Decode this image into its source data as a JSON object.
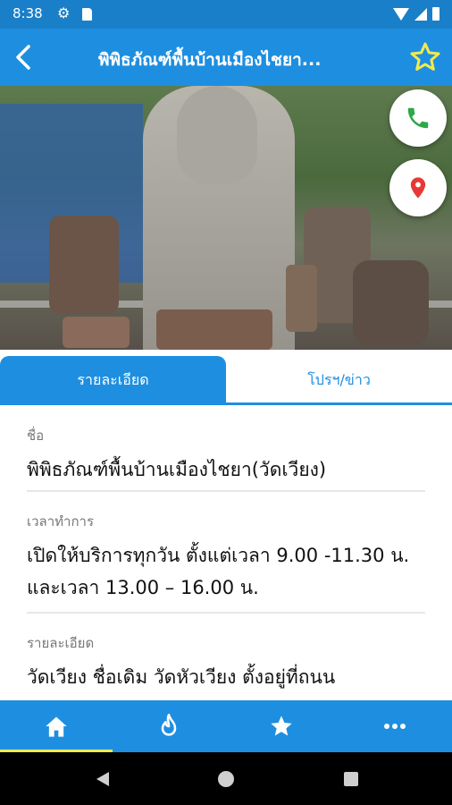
{
  "status_bar": {
    "time": "8:38",
    "icons": [
      "gear-icon",
      "sd-card-icon",
      "wifi-icon",
      "signal-icon",
      "battery-icon"
    ]
  },
  "app_bar": {
    "title": "พิพิธภัณฑ์พื้นบ้านเมืองไชยา...",
    "back_icon": "back-arrow-icon",
    "favorite_icon": "star-outline-icon",
    "background": "#1e8fe0",
    "star_color": "#f2e94e"
  },
  "hero": {
    "image": "photo-stone-statue"
  },
  "fabs": {
    "call_icon": "phone-icon",
    "map_icon": "map-pin-icon",
    "call_color": "#2ea84a",
    "map_color": "#e53935"
  },
  "tabs": [
    {
      "label": "รายละเอียด",
      "active": true
    },
    {
      "label": "โปรฯ/ข่าว",
      "active": false
    }
  ],
  "details": {
    "name_label": "ชื่อ",
    "name_value": "พิพิธภัณฑ์พื้นบ้านเมืองไชยา(วัดเวียง)",
    "hours_label": "เวลาทำการ",
    "hours_line1": "เปิดให้บริการทุกวัน ตั้งแต่เวลา 9.00 -11.30 น.",
    "hours_line2": "และเวลา 13.00 – 16.00 น.",
    "desc_label": "รายละเอียด",
    "desc_line1": "วัดเวียง ชื่อเดิม วัดหัวเวียง ตั้งอยู่ที่ถนน"
  },
  "bottom_nav": [
    {
      "icon": "home-icon",
      "active": true
    },
    {
      "icon": "fire-icon",
      "active": false
    },
    {
      "icon": "star-icon",
      "active": false
    },
    {
      "icon": "more-icon",
      "active": false
    }
  ],
  "system_nav": [
    "back-triangle-icon",
    "home-circle-icon",
    "recents-square-icon"
  ]
}
